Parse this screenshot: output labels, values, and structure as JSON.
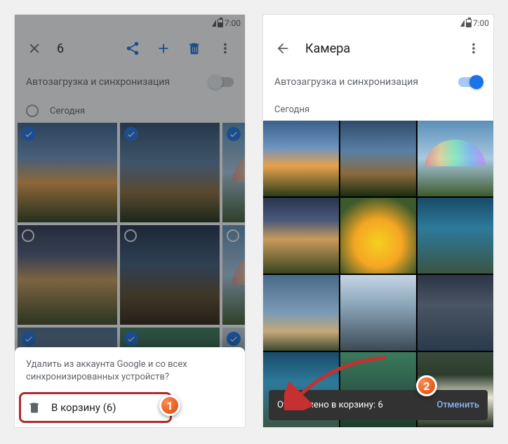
{
  "left": {
    "status": {
      "time": "7:00"
    },
    "appbar": {
      "count": "6"
    },
    "sync": {
      "label": "Автозагрузка и синхронизация"
    },
    "section": {
      "label": "Сегодня"
    },
    "sheet": {
      "message": "Удалить из аккаунта Google и со всех синхронизированных устройств?",
      "action": "В корзину (6)"
    },
    "badge": "1"
  },
  "right": {
    "status": {
      "time": "7:00"
    },
    "appbar": {
      "title": "Камера"
    },
    "sync": {
      "label": "Автозагрузка и синхронизация"
    },
    "section": {
      "label": "Сегодня"
    },
    "snackbar": {
      "message": "Отправлено в корзину: 6",
      "undo": "Отменить"
    },
    "badge": "2"
  }
}
